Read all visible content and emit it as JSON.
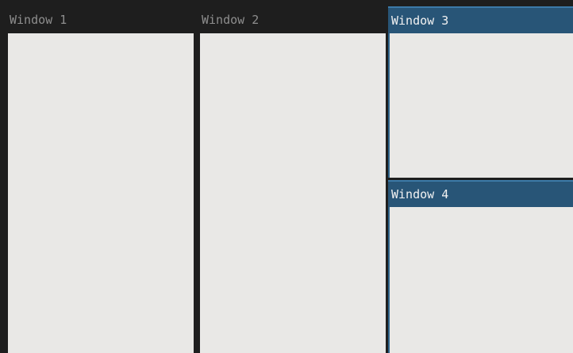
{
  "windows": [
    {
      "title": "Window 1",
      "focused": false
    },
    {
      "title": "Window 2",
      "focused": false
    },
    {
      "title": "Window 3",
      "focused": true
    },
    {
      "title": "Window 4",
      "focused": true
    }
  ],
  "colors": {
    "background": "#1e1e1e",
    "unfocused_title_bg": "#1e1e1e",
    "unfocused_title_text": "#8e8e8e",
    "focused_title_bg": "#285577",
    "focused_title_text": "#f2f2f2",
    "content_bg": "#e9e8e6"
  }
}
